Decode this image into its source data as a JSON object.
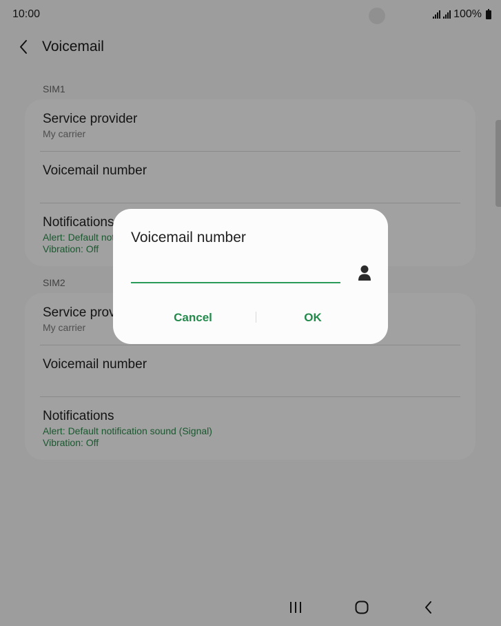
{
  "status_bar": {
    "time": "10:00",
    "battery": "100%"
  },
  "header": {
    "title": "Voicemail"
  },
  "sim1": {
    "label": "SIM1",
    "rows": [
      {
        "title": "Service provider",
        "subtitle": "My carrier"
      },
      {
        "title": "Voicemail number"
      },
      {
        "title": "Notifications",
        "alert": "Alert: Default notification sound (Signal)",
        "vibration": "Vibration: Off"
      }
    ]
  },
  "sim2": {
    "label": "SIM2",
    "rows": [
      {
        "title": "Service provider",
        "subtitle": "My carrier"
      },
      {
        "title": "Voicemail number"
      },
      {
        "title": "Notifications",
        "alert": "Alert: Default notification sound (Signal)",
        "vibration": "Vibration: Off"
      }
    ]
  },
  "dialog": {
    "title": "Voicemail number",
    "input_value": "",
    "cancel_label": "Cancel",
    "ok_label": "OK"
  },
  "colors": {
    "accent": "#238a4c",
    "input_underline": "#2a9a58",
    "secondary_text_green": "#2a8a4a"
  },
  "icons": [
    "back-arrow-icon",
    "contact-icon",
    "recent-apps-icon",
    "home-icon",
    "nav-back-icon",
    "signal-icon",
    "battery-icon"
  ]
}
